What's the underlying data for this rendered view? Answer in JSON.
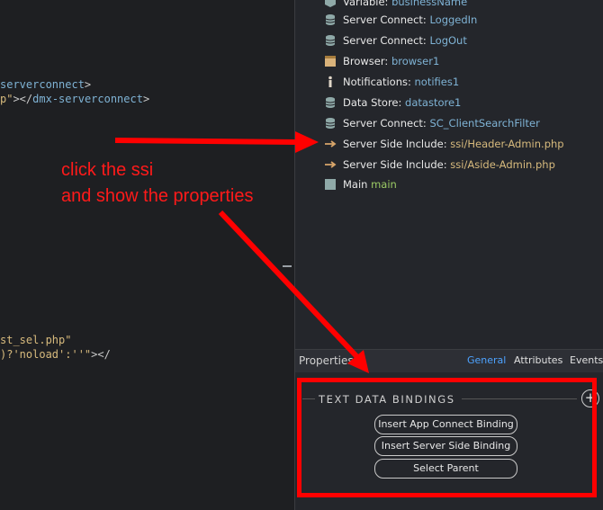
{
  "editor": {
    "lines": [
      {
        "parts": [
          {
            "cls": "tok-el",
            "text": "serverconnect"
          },
          {
            "cls": "tok-tag",
            "text": ">"
          }
        ]
      },
      {
        "parts": [
          {
            "cls": "tok-str",
            "text": "p\""
          },
          {
            "cls": "tok-tag",
            "text": "></"
          },
          {
            "cls": "tok-el",
            "text": "dmx-serverconnect"
          },
          {
            "cls": "tok-tag",
            "text": ">"
          }
        ]
      },
      {
        "parts": [
          {
            "cls": "tok-str",
            "text": "st_sel.php\""
          }
        ]
      },
      {
        "parts": [
          {
            "cls": "tok-str",
            "text": ")?'noload':''\""
          },
          {
            "cls": "tok-tag",
            "text": "></"
          }
        ]
      }
    ]
  },
  "tree": {
    "items": [
      {
        "type": "Variable:",
        "value": "businessName",
        "icon": "box-icon"
      },
      {
        "type": "Server Connect:",
        "value": "LoggedIn",
        "icon": "database-icon"
      },
      {
        "type": "Server Connect:",
        "value": "LogOut",
        "icon": "database-icon"
      },
      {
        "type": "Browser:",
        "value": "browser1",
        "icon": "browser-icon"
      },
      {
        "type": "Notifications:",
        "value": "notifies1",
        "icon": "info-icon"
      },
      {
        "type": "Data Store:",
        "value": "datastore1",
        "icon": "database-icon"
      },
      {
        "type": "Server Connect:",
        "value": "SC_ClientSearchFilter",
        "icon": "database-icon"
      },
      {
        "type": "Server Side Include:",
        "value": "ssi/Header-Admin.php",
        "icon": "arrow-right-icon"
      },
      {
        "type": "Server Side Include:",
        "value": "ssi/Aside-Admin.php",
        "icon": "arrow-right-icon"
      },
      {
        "type": "Main",
        "value": "main",
        "icon": "square-icon"
      }
    ]
  },
  "properties": {
    "title": "Properties",
    "tabs": [
      "General",
      "Attributes",
      "Events"
    ],
    "active_tab": "General",
    "section_title": "TEXT DATA BINDINGS",
    "add_symbol": "+",
    "buttons": [
      "Insert App Connect Binding",
      "Insert Server Side Binding",
      "Select Parent"
    ]
  },
  "annotation": {
    "line1": "click the ssi",
    "line2": "and show the properties",
    "color": "#ff0000"
  }
}
